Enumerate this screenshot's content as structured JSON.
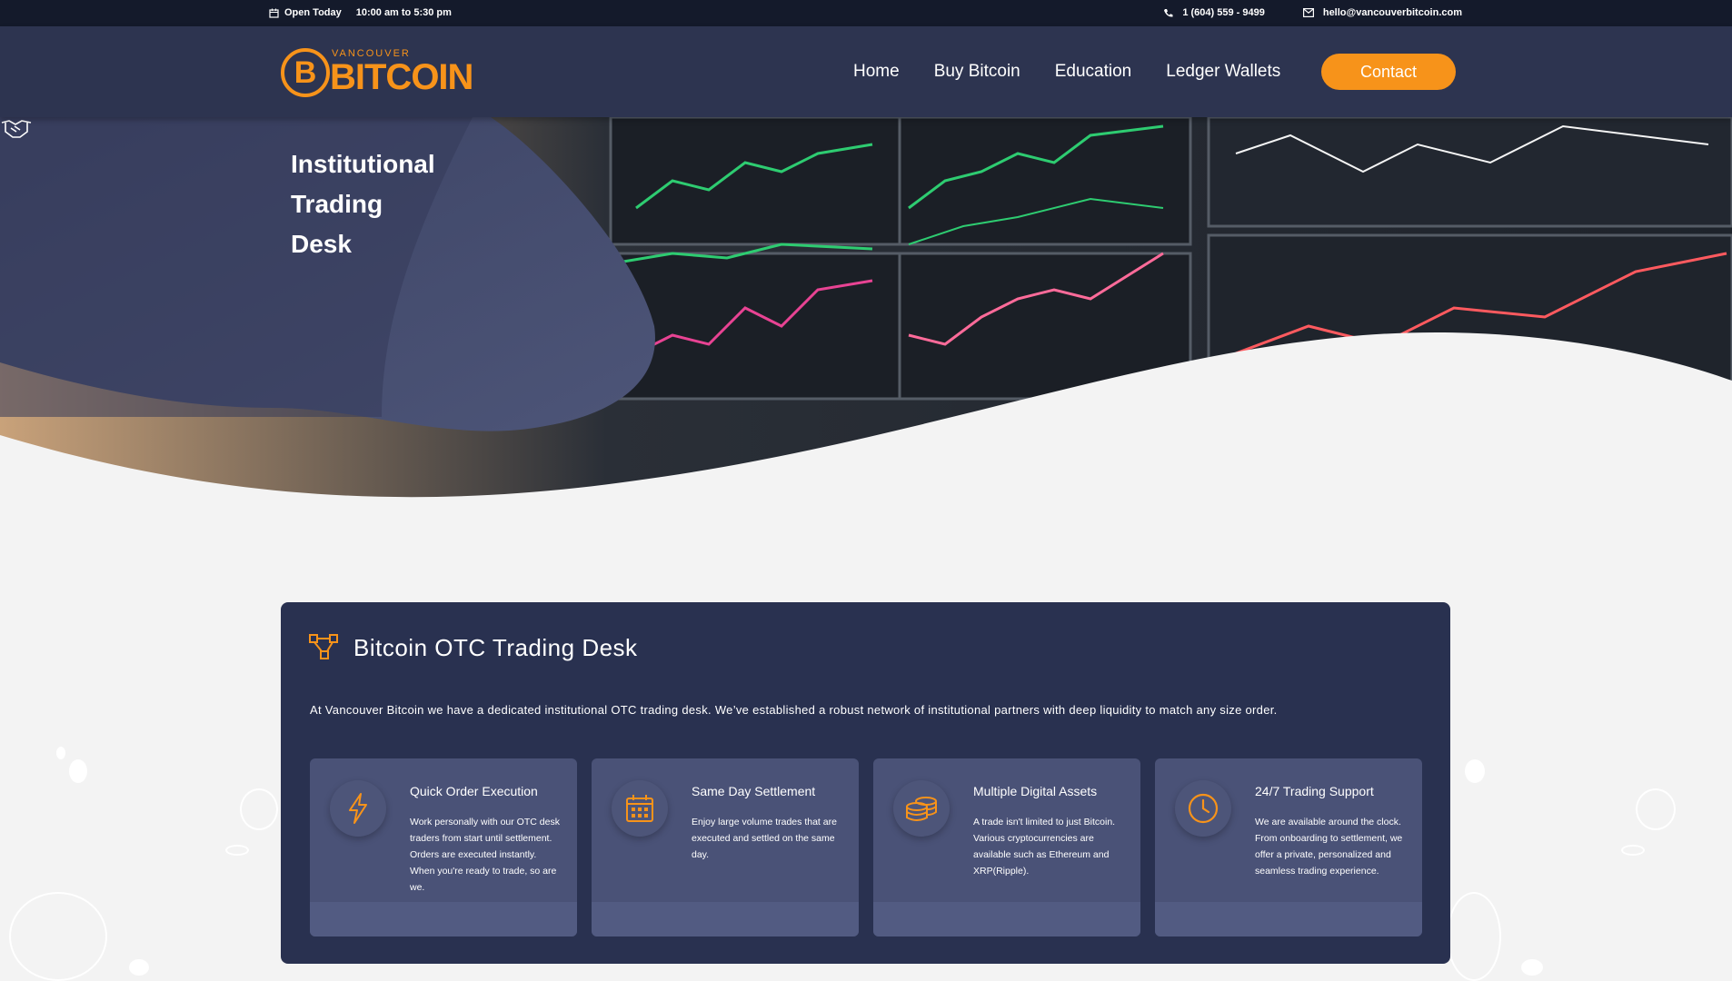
{
  "topbar": {
    "hours_label": "Open Today",
    "hours": "10:00 am to 5:30 pm",
    "phone": "1 (604) 559 - 9499",
    "email": "hello@vancouverbitcoin.com"
  },
  "logo": {
    "small": "VANCOUVER",
    "big": "BITCOIN",
    "mark": "B"
  },
  "nav": {
    "items": [
      "Home",
      "Buy Bitcoin",
      "Education",
      "Ledger Wallets"
    ],
    "cta": "Contact"
  },
  "hero": {
    "title_lines": [
      "Institutional",
      "Trading",
      "Desk"
    ]
  },
  "card": {
    "title": "Bitcoin OTC Trading Desk",
    "description": "At Vancouver Bitcoin we have a dedicated institutional OTC trading desk. We’ve established a robust network of institutional partners with deep liquidity to match any size order.",
    "features": [
      {
        "title": "Quick Order Execution",
        "icon": "lightning-icon",
        "body": "Work personally with our OTC desk traders from start until settlement. Orders are executed instantly. When you're ready to trade, so are we."
      },
      {
        "title": "Same Day Settlement",
        "icon": "calendar-icon",
        "body": "Enjoy large volume trades that are executed and settled on the same day."
      },
      {
        "title": "Multiple Digital Assets",
        "icon": "coins-icon",
        "body": "A trade isn't limited to just Bitcoin. Various cryptocurrencies are available such as Ethereum and XRP(Ripple)."
      },
      {
        "title": "24/7 Trading Support",
        "icon": "clock-icon",
        "body": "We are available around the clock. From onboarding to settlement, we offer a private, personalized and seamless trading experience."
      }
    ]
  },
  "colors": {
    "accent": "#f7931a",
    "navy": "#2d3450",
    "card": "#293150",
    "feature": "#4a5277"
  }
}
